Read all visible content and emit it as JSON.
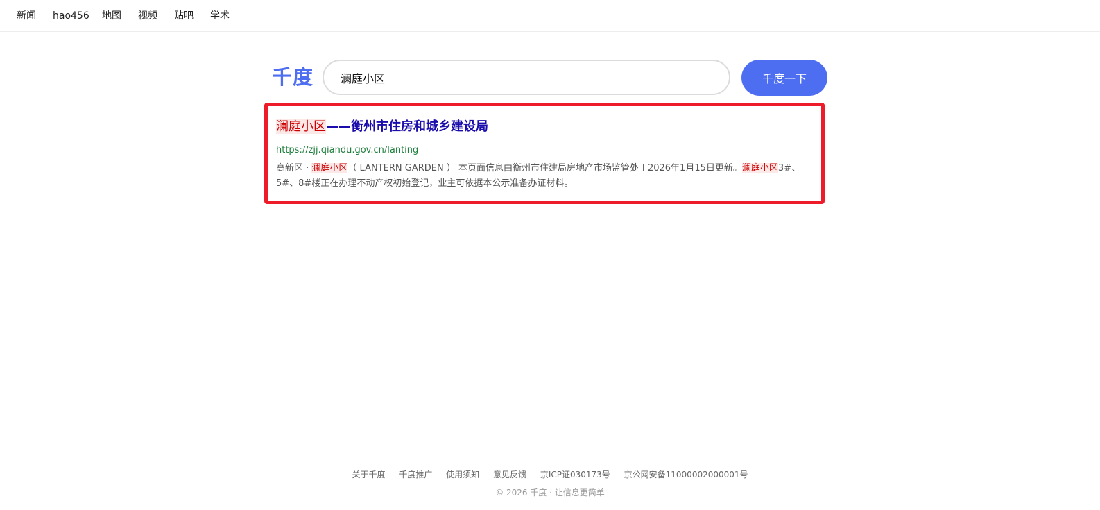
{
  "topnav": {
    "items": [
      "新闻",
      "hao456",
      "地图",
      "视频",
      "贴吧",
      "学术"
    ]
  },
  "logo": "千度",
  "search": {
    "query": "澜庭小区",
    "button_label": "千度一下"
  },
  "result": {
    "title_highlight": "澜庭小区",
    "title_rest": "——衡州市住房和城乡建设局",
    "url": "https://zjj.qiandu.gov.cn/lanting",
    "snippet_prefix": "高新区 · ",
    "snippet_hl1": "澜庭小区",
    "snippet_mid": "（ LANTERN GARDEN ） 本页面信息由衡州市住建局房地产市场监管处于2026年1月15日更新。",
    "snippet_hl2": "澜庭小区",
    "snippet_suffix": "3#、5#、8#楼正在办理不动产权初始登记，业主可依据本公示准备办证材料。",
    "highlight_color": "#ee1c2b"
  },
  "footer": {
    "links": [
      "关于千度",
      "千度推广",
      "使用须知",
      "意见反馈",
      "京ICP证030173号",
      "京公网安备11000002000001号"
    ],
    "copyright": "© 2026 千度 · 让信息更简单"
  },
  "colors": {
    "brand": "#4e6ef2",
    "title_link": "#1a0dab",
    "url_green": "#1d7f3b"
  }
}
